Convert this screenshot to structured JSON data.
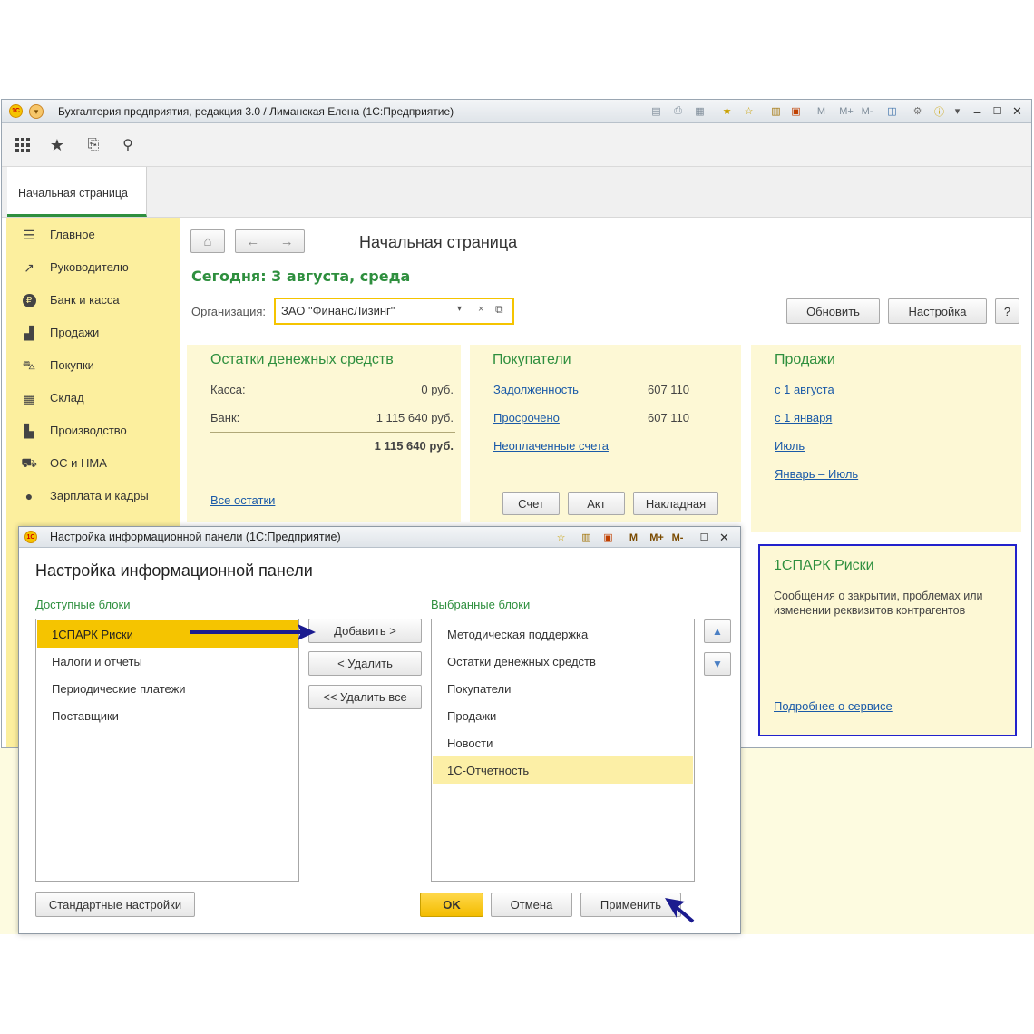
{
  "app": {
    "title": "Бухгалтерия предприятия, редакция 3.0 / Лиманская Елена  (1С:Предприятие)",
    "logo": "1С",
    "title_icons": [
      "save-icon",
      "print-icon",
      "preview-icon",
      "favorite-add-icon",
      "favorites-icon",
      "calculator-icon",
      "calendar-icon",
      "m-memory-icon",
      "m-plus-icon",
      "m-minus-icon",
      "panel-icon",
      "tools-icon",
      "info-icon",
      "minimize-icon",
      "maximize-icon",
      "close-icon"
    ],
    "mem": {
      "m": "M",
      "mplus": "M+",
      "mminus": "M-"
    }
  },
  "toolbar": {
    "icons": [
      "apps-grid-icon",
      "star-icon",
      "history-icon",
      "search-icon"
    ]
  },
  "tabs": {
    "home": "Начальная страница"
  },
  "sidebar": {
    "items": [
      {
        "label": "Главное",
        "icon": "menu-lines-icon"
      },
      {
        "label": "Руководителю",
        "icon": "trend-icon"
      },
      {
        "label": "Банк и касса",
        "icon": "ruble-icon"
      },
      {
        "label": "Продажи",
        "icon": "bag-icon"
      },
      {
        "label": "Покупки",
        "icon": "cart-icon"
      },
      {
        "label": "Склад",
        "icon": "grid-icon"
      },
      {
        "label": "Производство",
        "icon": "factory-icon"
      },
      {
        "label": "ОС и НМА",
        "icon": "truck-icon"
      },
      {
        "label": "Зарплата и кадры",
        "icon": "person-icon"
      }
    ]
  },
  "content": {
    "page_title": "Начальная страница",
    "today": "Сегодня: 3 августа, среда",
    "org_label": "Организация:",
    "org_value": "ЗАО \"ФинансЛизинг\"",
    "refresh_btn": "Обновить",
    "settings_btn": "Настройка",
    "help_btn": "?"
  },
  "cash": {
    "title": "Остатки денежных средств",
    "rows": [
      {
        "label": "Касса:",
        "value": "0 руб."
      },
      {
        "label": "Банк:",
        "value": "1 115 640 руб."
      }
    ],
    "total": "1 115 640 руб.",
    "all_link": "Все остатки"
  },
  "buyers": {
    "title": "Покупатели",
    "rows": [
      {
        "label": "Задолженность",
        "value": "607 110"
      },
      {
        "label": "Просрочено",
        "value": "607 110"
      },
      {
        "label": "Неоплаченные счета",
        "value": ""
      }
    ],
    "buttons": [
      "Счет",
      "Акт",
      "Накладная"
    ]
  },
  "sales": {
    "title": "Продажи",
    "links": [
      "с 1 августа",
      "с 1 января",
      "Июль",
      "Январь – Июль"
    ]
  },
  "spark": {
    "title": "1СПАРК Риски",
    "text": "Сообщения о закрытии, проблемах или изменении реквизитов контрагентов",
    "link": "Подробнее о сервисе"
  },
  "dialog": {
    "title": "Настройка информационной панели  (1С:Предприятие)",
    "heading": "Настройка информационной панели",
    "available_label": "Доступные блоки",
    "selected_label": "Выбранные блоки",
    "available": [
      "1СПАРК Риски",
      "Налоги и отчеты",
      "Периодические платежи",
      "Поставщики"
    ],
    "selected": [
      "Методическая поддержка",
      "Остатки денежных средств",
      "Покупатели",
      "Продажи",
      "Новости",
      "1С-Отчетность"
    ],
    "add_btn": "Добавить >",
    "remove_btn": "< Удалить",
    "remove_all_btn": "<< Удалить все",
    "defaults_btn": "Стандартные настройки",
    "ok_btn": "OK",
    "cancel_btn": "Отмена",
    "apply_btn": "Применить"
  },
  "colors": {
    "accent_green": "#2e8f3e",
    "selection_yellow": "#f5c400",
    "link_blue": "#1a5aa8",
    "arrow_navy": "#1b1b8f"
  }
}
